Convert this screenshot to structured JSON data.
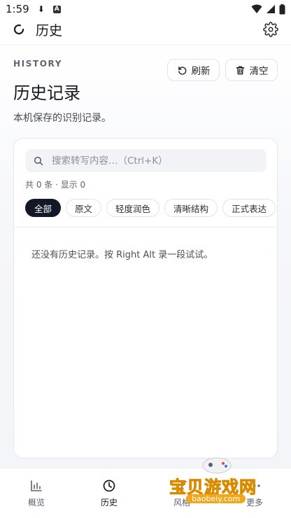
{
  "status": {
    "time": "1:59"
  },
  "appbar": {
    "title": "历史"
  },
  "page": {
    "eyebrow": "HISTORY",
    "title": "历史记录",
    "subtitle": "本机保存的识别记录。",
    "refresh_label": "刷新",
    "clear_label": "清空"
  },
  "search": {
    "placeholder": "搜索转写内容…（Ctrl+K）",
    "value": ""
  },
  "count": "共 0 条 · 显示 0",
  "chips": [
    {
      "label": "全部",
      "active": true
    },
    {
      "label": "原文",
      "active": false
    },
    {
      "label": "轻度润色",
      "active": false
    },
    {
      "label": "清晰结构",
      "active": false
    },
    {
      "label": "正式表达",
      "active": false
    }
  ],
  "empty_message": "还没有历史记录。按 Right Alt 录一段试试。",
  "nav": [
    {
      "label": "概览",
      "icon": "bar-chart-icon",
      "active": false
    },
    {
      "label": "历史",
      "icon": "clock-icon",
      "active": true
    },
    {
      "label": "风格",
      "icon": "style-icon",
      "active": false
    },
    {
      "label": "更多",
      "icon": "more-icon",
      "active": false
    }
  ],
  "watermark": {
    "text": "宝贝游戏网",
    "url": "baobeiy.com"
  },
  "colors": {
    "accent": "#121826",
    "watermark": "#f5b21a"
  }
}
